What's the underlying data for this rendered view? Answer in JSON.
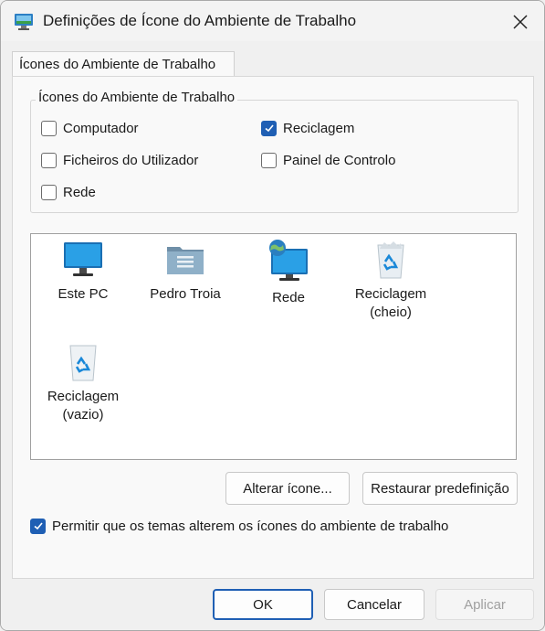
{
  "window": {
    "title": "Definições de Ícone do Ambiente de Trabalho"
  },
  "tabs": [
    {
      "label": "Ícones do Ambiente de Trabalho"
    }
  ],
  "group": {
    "legend": "Ícones do Ambiente de Trabalho",
    "checkboxes": [
      {
        "label": "Computador",
        "checked": false
      },
      {
        "label": "Reciclagem",
        "checked": true
      },
      {
        "label": "Ficheiros do Utilizador",
        "checked": false
      },
      {
        "label": "Painel de Controlo",
        "checked": false
      },
      {
        "label": "Rede",
        "checked": false
      }
    ]
  },
  "icons": [
    {
      "label": "Este PC",
      "icon": "monitor-icon"
    },
    {
      "label": "Pedro Troia",
      "icon": "user-folder-icon"
    },
    {
      "label": "Rede",
      "icon": "network-monitor-icon"
    },
    {
      "label": "Reciclagem\n(cheio)",
      "icon": "recycle-bin-full-icon"
    },
    {
      "label": "Reciclagem\n(vazio)",
      "icon": "recycle-bin-empty-icon"
    }
  ],
  "buttons": {
    "change_icon": "Alterar ícone...",
    "restore_default": "Restaurar predefinição",
    "ok": "OK",
    "cancel": "Cancelar",
    "apply": "Aplicar"
  },
  "allow_themes": {
    "label": "Permitir que os temas alterem os ícones do ambiente de trabalho",
    "checked": true
  },
  "colors": {
    "accent": "#1f5fb4",
    "monitor": "#1d8fd8"
  }
}
